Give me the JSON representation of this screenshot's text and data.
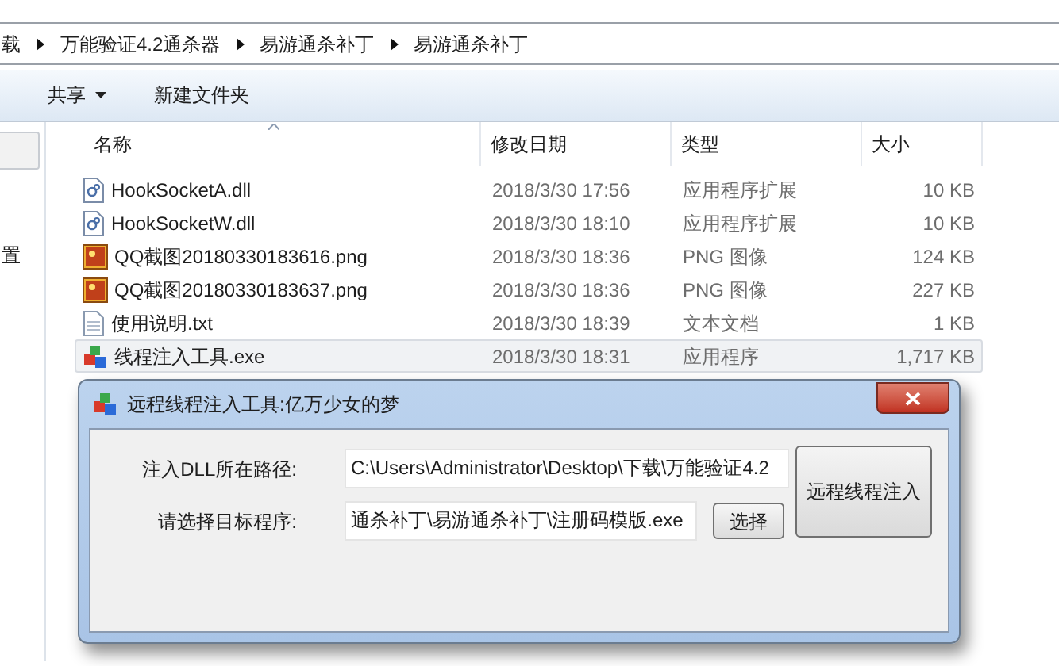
{
  "address_bar": {
    "crumbs": [
      "载",
      "万能验证4.2通杀器",
      "易游通杀补丁",
      "易游通杀补丁"
    ]
  },
  "toolbar": {
    "items": [
      {
        "label": "共享",
        "kind": "dropdown"
      },
      {
        "label": "新建文件夹",
        "kind": "button"
      }
    ]
  },
  "sidebar": {
    "items": [
      "置"
    ]
  },
  "table": {
    "columns": [
      "名称",
      "修改日期",
      "类型",
      "大小"
    ],
    "rows": [
      {
        "name": "HookSocketA.dll",
        "kind": "dll",
        "modified": "2018/3/30 17:56",
        "type": "应用程序扩展",
        "size": "10 KB",
        "selected": false
      },
      {
        "name": "HookSocketW.dll",
        "kind": "dll",
        "modified": "2018/3/30 18:10",
        "type": "应用程序扩展",
        "size": "10 KB",
        "selected": false
      },
      {
        "name": "QQ截图20180330183616.png",
        "kind": "image",
        "modified": "2018/3/30 18:36",
        "type": "PNG 图像",
        "size": "124 KB",
        "selected": false
      },
      {
        "name": "QQ截图20180330183637.png",
        "kind": "image",
        "modified": "2018/3/30 18:36",
        "type": "PNG 图像",
        "size": "227 KB",
        "selected": false
      },
      {
        "name": "使用说明.txt",
        "kind": "text",
        "modified": "2018/3/30 18:39",
        "type": "文本文档",
        "size": "1 KB",
        "selected": false
      },
      {
        "name": "线程注入工具.exe",
        "kind": "exe",
        "modified": "2018/3/30 18:31",
        "type": "应用程序",
        "size": "1,717 KB",
        "selected": true
      }
    ]
  },
  "dialog": {
    "title": "远程线程注入工具:亿万少女的梦",
    "fields": [
      {
        "label": "注入DLL所在路径:",
        "value": "C:\\Users\\Administrator\\Desktop\\下载\\万能验证4.2"
      },
      {
        "label": "请选择目标程序:",
        "value": "通杀补丁\\易游通杀补丁\\注册码模版.exe",
        "button": "选择"
      }
    ],
    "action_button": "远程线程注入"
  }
}
